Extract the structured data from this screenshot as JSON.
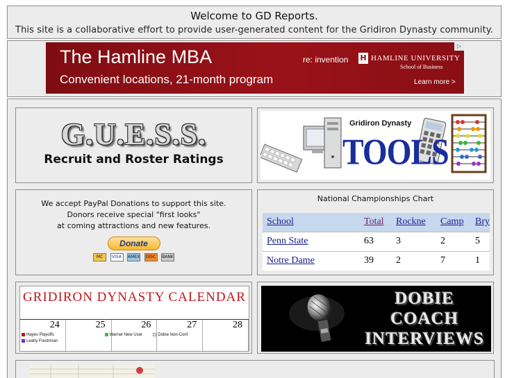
{
  "welcome": {
    "title": "Welcome to GD Reports.",
    "subtitle": "This site is a collaborative effort to provide user-generated content for the Gridiron Dynasty community."
  },
  "ad": {
    "headline": "The Hamline MBA",
    "tagline": "Convenient locations, 21-month program",
    "reinvention": "re: invention",
    "logo_letter": "H",
    "university": "HAMLINE UNIVERSITY",
    "school": "School of Business",
    "cta": "Learn more >",
    "adchoice": "▷"
  },
  "guess": {
    "title": "G.U.E.S.S.",
    "subtitle": "Recruit and Roster Ratings"
  },
  "tools": {
    "brand": "Gridiron Dynasty",
    "word": "TOOLS"
  },
  "donate": {
    "line1": "We accept PayPal Donations to support this site.",
    "line2": "Donors receive special \"first looks\"",
    "line3": "at coming attractions and new features.",
    "button": "Donate",
    "cards": [
      "MC",
      "VISA",
      "AMEX",
      "DISC",
      "BANK"
    ]
  },
  "championships": {
    "title": "National Championships Chart",
    "columns": [
      "School",
      "Total",
      "Rockne",
      "Camp",
      "Bryant"
    ],
    "rows": [
      [
        "Penn State",
        "63",
        "3",
        "2",
        "5"
      ],
      [
        "Notre Dame",
        "39",
        "2",
        "7",
        "1"
      ]
    ]
  },
  "calendar": {
    "title": "GRIDIRON DYNASTY CALENDAR",
    "days": [
      "24",
      "25",
      "26",
      "27",
      "28"
    ],
    "events": {
      "e1": "Hayes Playoffs",
      "e2": "Leahy Freshman",
      "e3": "Warner New User",
      "e4": "Dobie Non-Conf"
    },
    "colors": {
      "hayes": "#c0161c",
      "leahy": "#5a36c8",
      "warner": "#3cc03c",
      "dobie": "#e8e8e8"
    }
  },
  "dobie": {
    "line1": "DOBIE",
    "line2": "COACH",
    "line3": "INTERVIEWS"
  }
}
